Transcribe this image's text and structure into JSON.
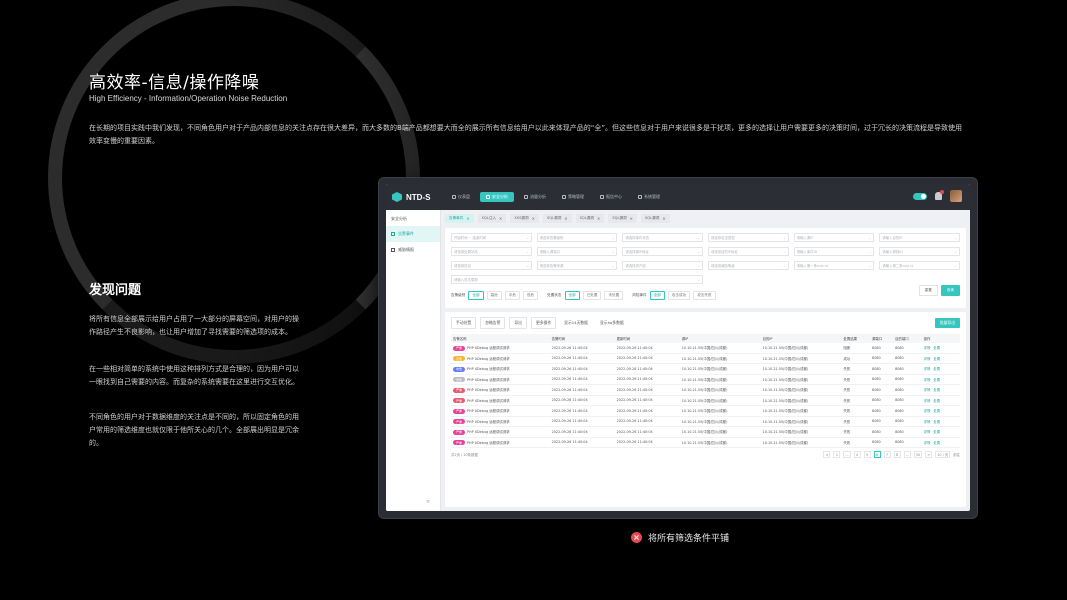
{
  "heading": {
    "title": "高效率-信息/操作降噪",
    "subtitle": "High Efficiency - Information/Operation Noise Reduction",
    "intro": "在长期的项目实践中我们发现，不同角色用户对于产品内部信息的关注点存在很大差异，而大多数的B端产品都想要大而全的展示所有信息给用户以此来体现产品的“全”。但这些信息对于用户来说很多是干扰项，更多的选择让用户需要更多的决策时间，过于冗长的决策流程是导致使用效率变慢的重要因素。"
  },
  "problem": {
    "title": "发现问题",
    "p1": "将所有信息全部展示给用户占用了一大部分的屏幕空间，对用户的操作路径产生不良影响，也让用户增加了寻找需要的筛选项的成本。",
    "p2": "在一些相对简单的系统中使用这种排列方式是合理的，因为用户可以一眼找到自己需要的内容。而复杂的系统需要在这里进行交互优化。",
    "p3": "不同角色的用户对于数据维度的关注点是不同的，所以固定角色的用户常用的筛选维度也就仅限于他所关心的几个。全部展出明显是冗余的。"
  },
  "app": {
    "logo": "NTD-S",
    "nav": [
      "仪表盘",
      "安全分析",
      "流量分析",
      "策略管理",
      "报告中心",
      "系统管理"
    ],
    "active_nav": 1,
    "sidebar": {
      "head": "安全分析",
      "items": [
        "告警事件",
        "威胁情报"
      ]
    },
    "tabs": [
      "告警事件",
      "SQL注入",
      "XSS漏洞",
      "SQL漏洞",
      "SQL漏洞",
      "SQL漏洞",
      "SQL漏洞"
    ],
    "filters": [
      "开始时间 ~ 结束时间",
      "请选择告警级别",
      "请选择事件状态",
      "请选择攻击类型",
      "请输入源IP",
      "请输入目的IP",
      "请选择处置状态",
      "请输入源端口",
      "请选择源IP地址",
      "请选择目的IP地址",
      "请输入事件ID",
      "请输入规则ID",
      "请选择协议",
      "请选择告警来源",
      "请选择资产组",
      "请选择威胁等级",
      "请输入第一条rule id",
      "请输入第二条rule id",
      "请输入攻击载荷"
    ],
    "filter_buttons": {
      "reset": "重置",
      "search": "查询"
    },
    "quick": [
      {
        "label": "告警级别",
        "chips": [
          "全部",
          "高危",
          "中危",
          "低危"
        ],
        "on": 0
      },
      {
        "label": "处置状态",
        "chips": [
          "全部",
          "已处置",
          "未处置"
        ],
        "on": 0
      },
      {
        "label": "风险事件",
        "chips": [
          "全部",
          "攻击成功",
          "攻击失败"
        ],
        "on": 0
      }
    ],
    "toolbar": [
      "手动处置",
      "忽略告警",
      "导出",
      "更多操作"
    ],
    "toolbar_checks": [
      "显示14天数据",
      "显示ho多数据"
    ],
    "export_label": "批量导出",
    "columns": [
      "告警名称",
      "告警时间",
      "更新时间",
      "源IP",
      "目的IP",
      "处置结果",
      "源端口",
      "目的端口",
      "操作"
    ],
    "rows": [
      {
        "tag": "严重",
        "color": "#e8439b",
        "name": "PHP XDebug 远程调试请求",
        "t1": "2022-09-26 11:40:04",
        "t2": "2022-09-26 11:40:04",
        "src": "10.10.21.55(中国/四川/成都)",
        "dst": "10.10.21.55(中国/四川/成都)",
        "res": "阻断",
        "sp": "8080",
        "dp": "8080"
      },
      {
        "tag": "高危",
        "color": "#f5b731",
        "name": "PHP XDebug 远程调试请求",
        "t1": "2022-09-26 11:40:04",
        "t2": "2022-09-26 11:40:04",
        "src": "10.10.21.55(中国/四川/成都)",
        "dst": "10.10.21.55(中国/四川/成都)",
        "res": "成功",
        "sp": "8080",
        "dp": "8080"
      },
      {
        "tag": "中危",
        "color": "#6b7cf0",
        "name": "PHP XDebug 远程调试请求",
        "t1": "2022-09-26 11:40:04",
        "t2": "2022-09-26 11:40:04",
        "src": "10.10.21.55(中国/四川/成都)",
        "dst": "10.10.21.55(中国/四川/成都)",
        "res": "失败",
        "sp": "8080",
        "dp": "8080"
      },
      {
        "tag": "低危",
        "color": "#b9bec6",
        "name": "PHP XDebug 远程调试请求",
        "t1": "2022-09-26 11:40:04",
        "t2": "2022-09-26 11:40:04",
        "src": "10.10.21.55(中国/四川/成都)",
        "dst": "10.10.21.55(中国/四川/成都)",
        "res": "失败",
        "sp": "8080",
        "dp": "8080"
      },
      {
        "tag": "严重",
        "color": "#e85a6f",
        "name": "PHP XDebug 远程调试请求",
        "t1": "2022-09-26 11:40:04",
        "t2": "2022-09-26 11:40:04",
        "src": "10.10.21.55(中国/四川/成都)",
        "dst": "10.10.21.55(中国/四川/成都)",
        "res": "失败",
        "sp": "8080",
        "dp": "8080"
      },
      {
        "tag": "严重",
        "color": "#e85a6f",
        "name": "PHP XDebug 远程调试请求",
        "t1": "2022-09-26 11:40:04",
        "t2": "2022-09-26 11:40:04",
        "src": "10.10.21.55(中国/四川/成都)",
        "dst": "10.10.21.55(中国/四川/成都)",
        "res": "失败",
        "sp": "8080",
        "dp": "8080"
      },
      {
        "tag": "严重",
        "color": "#e8439b",
        "name": "PHP XDebug 远程调试请求",
        "t1": "2022-09-26 11:40:04",
        "t2": "2022-09-26 11:40:04",
        "src": "10.10.21.55(中国/四川/成都)",
        "dst": "10.10.21.55(中国/四川/成都)",
        "res": "失败",
        "sp": "8080",
        "dp": "8080"
      },
      {
        "tag": "严重",
        "color": "#e8439b",
        "name": "PHP XDebug 远程调试请求",
        "t1": "2022-09-26 11:40:04",
        "t2": "2022-09-26 11:40:04",
        "src": "10.10.21.55(中国/四川/成都)",
        "dst": "10.10.21.55(中国/四川/成都)",
        "res": "失败",
        "sp": "8080",
        "dp": "8080"
      },
      {
        "tag": "严重",
        "color": "#e8439b",
        "name": "PHP XDebug 远程调试请求",
        "t1": "2022-09-26 11:40:04",
        "t2": "2022-09-26 11:40:04",
        "src": "10.10.21.55(中国/四川/成都)",
        "dst": "10.10.21.55(中国/四川/成都)",
        "res": "失败",
        "sp": "8080",
        "dp": "8080"
      },
      {
        "tag": "严重",
        "color": "#e8439b",
        "name": "PHP XDebug 远程调试请求",
        "t1": "2022-09-26 11:40:04",
        "t2": "2022-09-26 11:40:04",
        "src": "10.10.21.55(中国/四川/成都)",
        "dst": "10.10.21.55(中国/四川/成都)",
        "res": "失败",
        "sp": "8080",
        "dp": "8080"
      }
    ],
    "row_actions": [
      "详情",
      "处置"
    ],
    "total": "共2页 / 10条数据",
    "pages": [
      "<",
      "1",
      "...",
      "4",
      "5",
      "6",
      "7",
      "8",
      "...",
      "50",
      ">"
    ],
    "current_page": "6",
    "page_size": "10 / 页",
    "jump": "前往"
  },
  "caption": "将所有筛选条件平铺",
  "colors": {
    "accent": "#35c6c0",
    "error": "#e5484d"
  }
}
